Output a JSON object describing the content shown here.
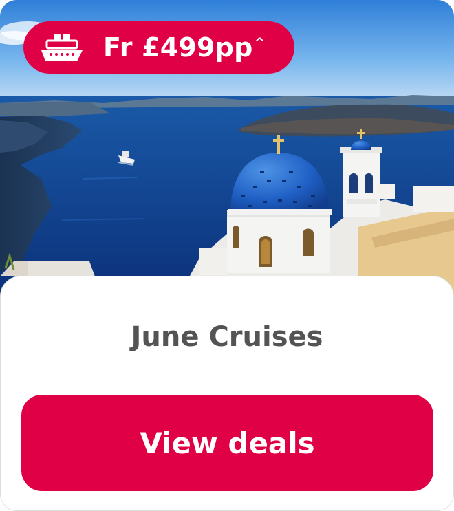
{
  "card": {
    "image_alt": "Santorini cruise view",
    "badge": {
      "icon": "cruise-ship-icon",
      "price_prefix": "Fr",
      "price": "£499pp",
      "price_suffix": "^"
    },
    "title": "June Cruises",
    "cta_label": "View deals"
  },
  "colors": {
    "brand": "#e00045",
    "title_text": "#545454",
    "button_text": "#ffffff"
  }
}
